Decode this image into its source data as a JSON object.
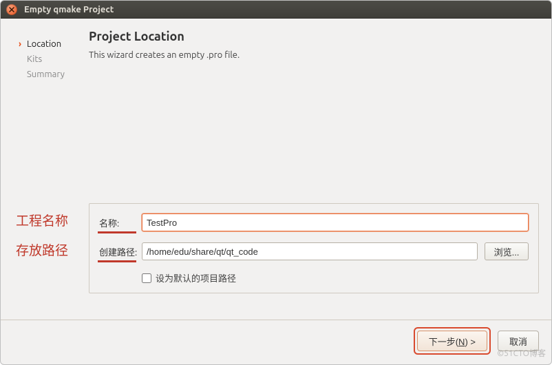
{
  "window": {
    "title": "Empty qmake Project"
  },
  "steps": {
    "items": [
      {
        "label": "Location",
        "active": true
      },
      {
        "label": "Kits",
        "active": false
      },
      {
        "label": "Summary",
        "active": false
      }
    ]
  },
  "content": {
    "heading": "Project Location",
    "description": "This wizard creates an empty .pro file."
  },
  "annot": {
    "project_name": "工程名称",
    "path": "存放路径"
  },
  "form": {
    "name_label": "名称:",
    "name_value": "TestPro",
    "path_label": "创建路径:",
    "path_value": "/home/edu/share/qt/qt_code",
    "browse_label": "浏览...",
    "default_path_label": "设为默认的项目路径",
    "default_path_checked": false
  },
  "footer": {
    "next_label_pre": "下一步(",
    "next_accesskey": "N",
    "next_label_post": ") >",
    "cancel_label": "取消"
  },
  "watermark": "©51CTO博客"
}
